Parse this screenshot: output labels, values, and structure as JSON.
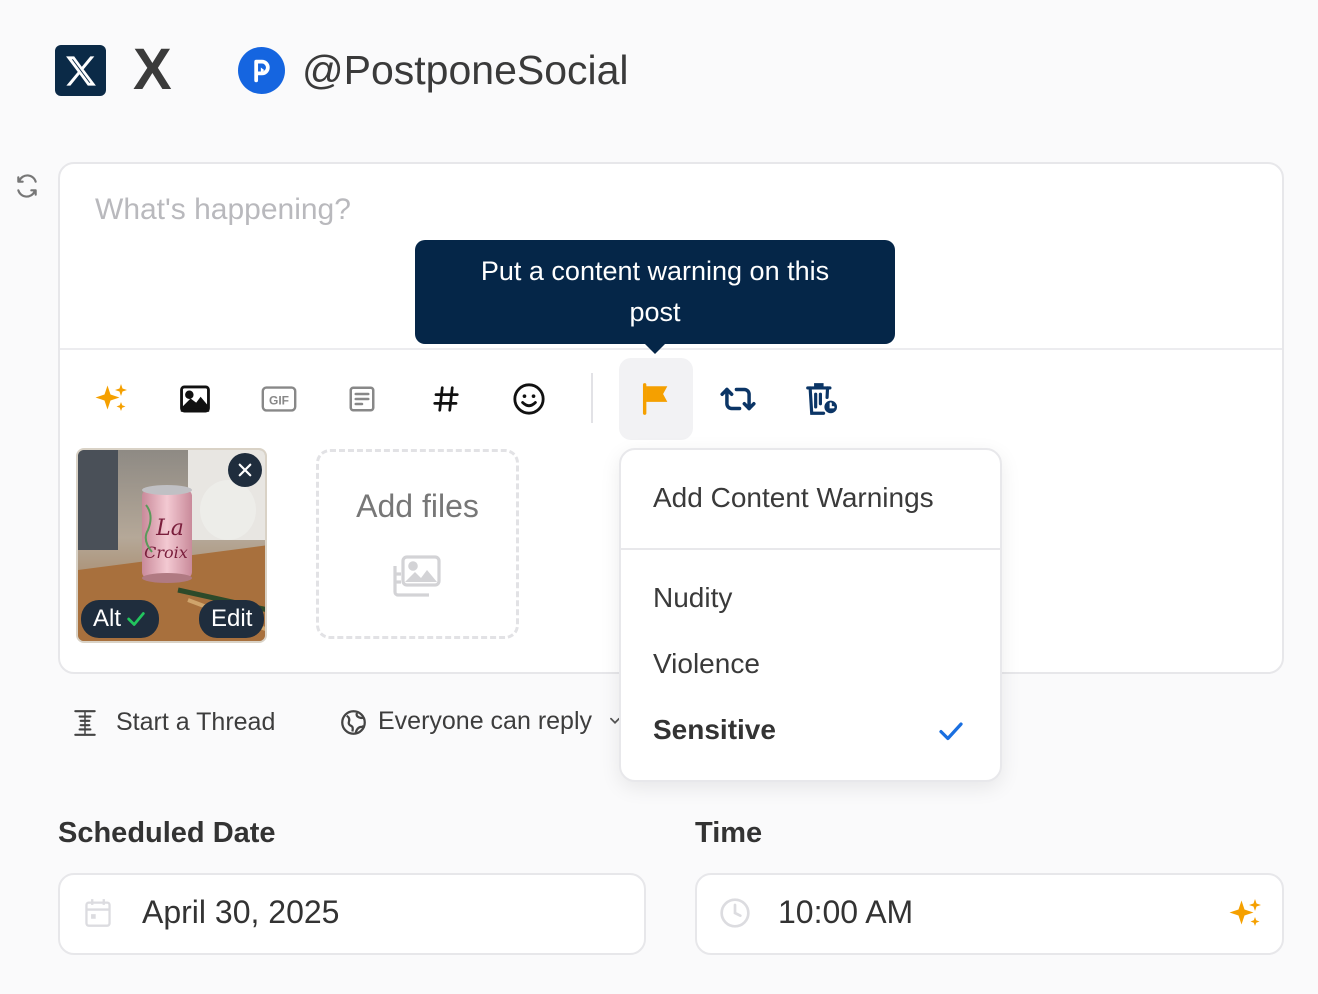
{
  "header": {
    "platform_name": "X",
    "account_handle": "@PostponeSocial"
  },
  "composer": {
    "placeholder": "What's happening?",
    "tooltip": "Put a content warning on this post",
    "toolbar": [
      "ai-sparkle-icon",
      "image-icon",
      "gif-icon",
      "template-icon",
      "hashtag-icon",
      "emoji-icon",
      "flag-icon",
      "repost-icon",
      "auto-delete-icon"
    ],
    "media": {
      "alt_label": "Alt",
      "edit_label": "Edit"
    },
    "add_files_label": "Add files"
  },
  "options": {
    "thread_label": "Start a Thread",
    "reply_label": "Everyone can reply"
  },
  "content_warnings": {
    "title": "Add Content Warnings",
    "items": [
      {
        "label": "Nudity",
        "selected": false
      },
      {
        "label": "Violence",
        "selected": false
      },
      {
        "label": "Sensitive",
        "selected": true
      }
    ]
  },
  "schedule": {
    "date_label": "Scheduled Date",
    "date_value": "April 30, 2025",
    "time_label": "Time",
    "time_value": "10:00 AM"
  },
  "colors": {
    "accent_orange": "#f5a000",
    "navy": "#052648",
    "check_blue": "#1a6fe0",
    "check_green": "#22c55e"
  }
}
